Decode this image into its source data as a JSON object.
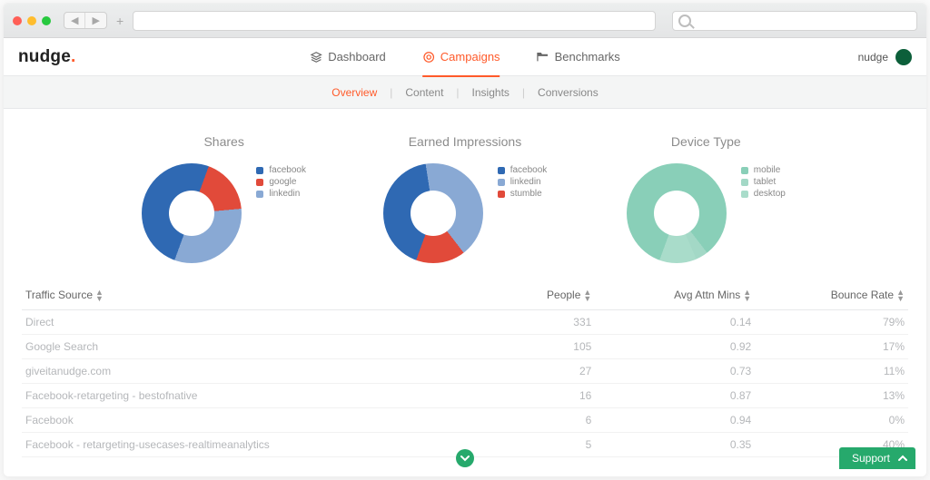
{
  "app": {
    "logo_text": "nudge",
    "user_label": "nudge",
    "tabs": [
      {
        "id": "dashboard",
        "label": "Dashboard",
        "active": false
      },
      {
        "id": "campaigns",
        "label": "Campaigns",
        "active": true
      },
      {
        "id": "benchmarks",
        "label": "Benchmarks",
        "active": false
      }
    ],
    "subtabs": [
      {
        "id": "overview",
        "label": "Overview",
        "active": true
      },
      {
        "id": "content",
        "label": "Content",
        "active": false
      },
      {
        "id": "insights",
        "label": "Insights",
        "active": false
      },
      {
        "id": "conversions",
        "label": "Conversions",
        "active": false
      }
    ]
  },
  "chart_data": [
    {
      "type": "pie",
      "title": "Shares",
      "series": [
        {
          "name": "facebook",
          "value": 50,
          "color": "#2f69b3"
        },
        {
          "name": "google",
          "value": 18,
          "color": "#e14a3a"
        },
        {
          "name": "linkedin",
          "value": 32,
          "color": "#89a9d4"
        }
      ]
    },
    {
      "type": "pie",
      "title": "Earned Impressions",
      "series": [
        {
          "name": "facebook",
          "value": 42,
          "color": "#2f69b3"
        },
        {
          "name": "linkedin",
          "value": 42,
          "color": "#89a9d4"
        },
        {
          "name": "stumble",
          "value": 16,
          "color": "#e14a3a"
        }
      ]
    },
    {
      "type": "pie",
      "title": "Device Type",
      "series": [
        {
          "name": "mobile",
          "value": 84,
          "color": "#89cfb8"
        },
        {
          "name": "tablet",
          "value": 4,
          "color": "#a3d8c6"
        },
        {
          "name": "desktop",
          "value": 12,
          "color": "#a9dcca"
        }
      ]
    }
  ],
  "table": {
    "columns": [
      {
        "key": "source",
        "label": "Traffic Source"
      },
      {
        "key": "people",
        "label": "People"
      },
      {
        "key": "attn",
        "label": "Avg Attn Mins"
      },
      {
        "key": "bounce",
        "label": "Bounce Rate"
      }
    ],
    "rows": [
      {
        "source": "Direct",
        "people": "331",
        "attn": "0.14",
        "bounce": "79%"
      },
      {
        "source": "Google Search",
        "people": "105",
        "attn": "0.92",
        "bounce": "17%"
      },
      {
        "source": "giveitanudge.com",
        "people": "27",
        "attn": "0.73",
        "bounce": "11%"
      },
      {
        "source": "Facebook-retargeting - bestofnative",
        "people": "16",
        "attn": "0.87",
        "bounce": "13%"
      },
      {
        "source": "Facebook",
        "people": "6",
        "attn": "0.94",
        "bounce": "0%"
      },
      {
        "source": "Facebook - retargeting-usecases-realtimeanalytics",
        "people": "5",
        "attn": "0.35",
        "bounce": "40%"
      }
    ]
  },
  "support_label": "Support"
}
